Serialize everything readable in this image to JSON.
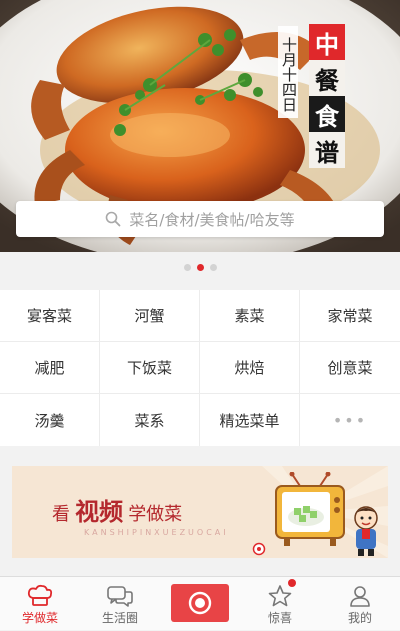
{
  "hero": {
    "date_vertical": "十月十四日",
    "title_chars": [
      "中",
      "餐",
      "食",
      "谱"
    ]
  },
  "search": {
    "placeholder": "菜名/食材/美食帖/哈友等",
    "icon": "search-icon"
  },
  "carousel": {
    "count": 3,
    "active_index": 1
  },
  "categories": [
    {
      "label": "宴客菜"
    },
    {
      "label": "河蟹"
    },
    {
      "label": "素菜"
    },
    {
      "label": "家常菜"
    },
    {
      "label": "减肥"
    },
    {
      "label": "下饭菜"
    },
    {
      "label": "烘焙"
    },
    {
      "label": "创意菜"
    },
    {
      "label": "汤羹"
    },
    {
      "label": "菜系"
    },
    {
      "label": "精选菜单"
    },
    {
      "label": "•••"
    }
  ],
  "promo": {
    "prefix": "看",
    "highlight": "视频",
    "suffix": "学做菜",
    "pinyin": "KANSHIPINXUEZUOCAI"
  },
  "tabbar": {
    "tabs": [
      {
        "label": "学做菜",
        "icon": "chef-hat-icon",
        "active": true
      },
      {
        "label": "生活圈",
        "icon": "chat-bubbles-icon",
        "active": false
      },
      {
        "label": "",
        "icon": "record-button-icon",
        "active": false
      },
      {
        "label": "惊喜",
        "icon": "star-icon",
        "active": false,
        "badge": true
      },
      {
        "label": "我的",
        "icon": "user-icon",
        "active": false
      }
    ]
  },
  "colors": {
    "accent": "#e0282b",
    "promo_bg": "#f6e6d4"
  }
}
